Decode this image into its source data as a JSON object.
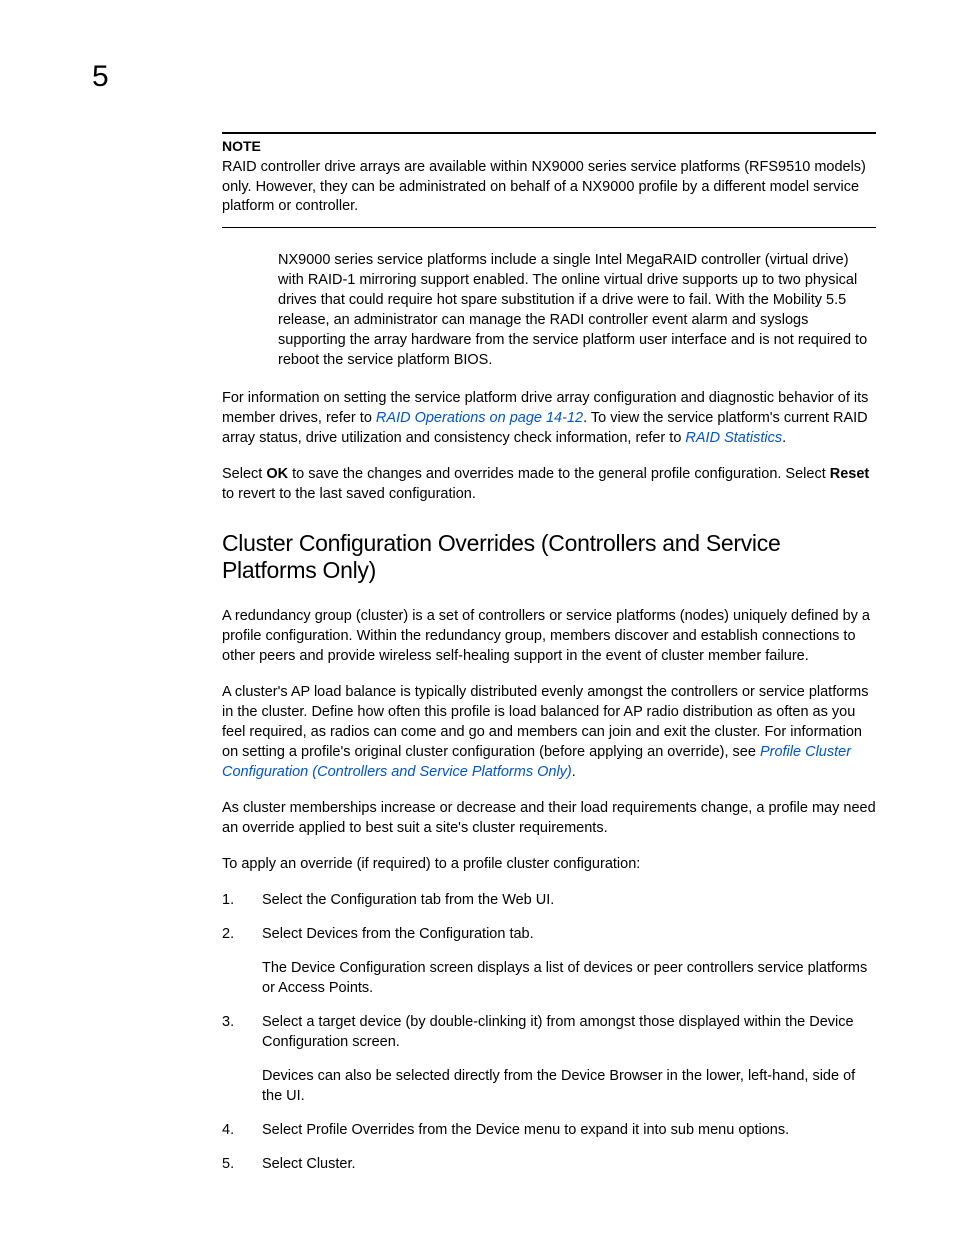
{
  "page_number": "5",
  "note": {
    "label": "NOTE",
    "body": "RAID controller drive arrays are available within NX9000 series service platforms (RFS9510 models) only. However, they can be administrated on behalf of a NX9000 profile by a different model service platform or controller."
  },
  "indented_para": "NX9000 series service platforms include a single Intel MegaRAID controller (virtual drive) with RAID-1 mirroring support enabled. The online virtual drive supports up to two physical drives that could require hot spare substitution if a drive were to fail. With the Mobility 5.5 release, an administrator can manage the RADI controller event alarm and syslogs supporting the array hardware from the service platform user interface and is not required to reboot the service platform BIOS.",
  "para_info": {
    "pre_link1": "For information on setting the service platform drive array configuration and diagnostic behavior of its member drives, refer to ",
    "link1": "RAID Operations on page 14-12",
    "mid": ". To view the service platform's current RAID array status, drive utilization and consistency check information, refer to ",
    "link2": "RAID Statistics",
    "end": "."
  },
  "para_select": {
    "pre_ok": "Select ",
    "ok": "OK",
    "mid": " to save the changes and overrides made to the general profile configuration. Select ",
    "reset": "Reset",
    "end": " to revert to the last saved configuration."
  },
  "heading": "Cluster Configuration Overrides (Controllers and Service Platforms Only)",
  "cluster_p1": "A redundancy group (cluster) is a set of controllers or service platforms (nodes) uniquely defined by a profile configuration. Within the redundancy group, members discover and establish connections to other peers and provide wireless self-healing support in the event of cluster member failure.",
  "cluster_p2": {
    "text": "A cluster's AP load balance is typically distributed evenly amongst the controllers or service platforms in the cluster. Define how often this profile is load balanced for AP radio distribution as often as you feel required, as radios can come and go and members can join and exit the cluster. For information on setting a profile's original cluster configuration (before applying an override), see ",
    "link": "Profile Cluster Configuration (Controllers and Service Platforms Only)",
    "end": "."
  },
  "cluster_p3": "As cluster memberships increase or decrease and their load requirements change, a profile may need an override applied to best suit a site's cluster requirements.",
  "cluster_p4": "To apply an override (if required) to a profile cluster configuration:",
  "steps": {
    "s1": {
      "pre": "Select the ",
      "bold": "Configuration",
      "post": " tab from the Web UI."
    },
    "s2": {
      "pre": "Select ",
      "bold": "Devices",
      "post": " from the Configuration tab.",
      "sub": "The Device Configuration screen displays a list of devices or peer controllers service platforms or Access Points."
    },
    "s3": {
      "text": "Select a target device (by double-clinking it) from amongst those displayed within the Device Configuration screen.",
      "sub": "Devices can also be selected directly from the Device Browser in the lower, left-hand, side of the UI."
    },
    "s4": {
      "pre": "Select ",
      "bold": "Profile Overrides",
      "post": " from the Device menu to expand it into sub menu options."
    },
    "s5": {
      "pre": "Select ",
      "bold": "Cluster",
      "post": "."
    }
  }
}
